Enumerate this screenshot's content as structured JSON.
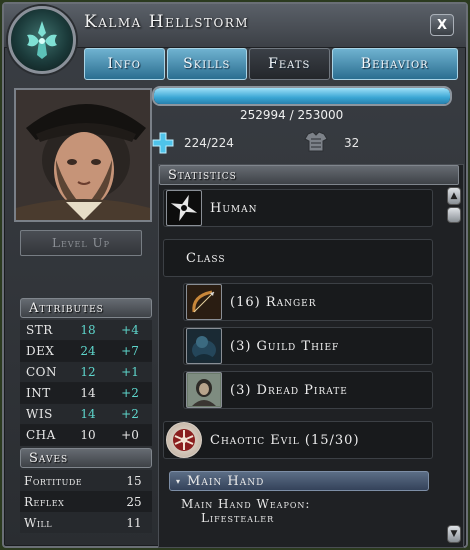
{
  "window": {
    "title": "Kalma Hellstorm",
    "close_label": "X"
  },
  "tabs": [
    {
      "label": "Info"
    },
    {
      "label": "Skills"
    },
    {
      "label": "Feats"
    },
    {
      "label": "Behavior"
    }
  ],
  "left": {
    "level_up_label": "Level Up",
    "attributes_title": "Attributes",
    "attributes": [
      {
        "name": "STR",
        "value": "18",
        "mod": "+4"
      },
      {
        "name": "DEX",
        "value": "24",
        "mod": "+7"
      },
      {
        "name": "CON",
        "value": "12",
        "mod": "+1"
      },
      {
        "name": "INT",
        "value": "14",
        "mod": "+2"
      },
      {
        "name": "WIS",
        "value": "14",
        "mod": "+2"
      },
      {
        "name": "CHA",
        "value": "10",
        "mod": "+0"
      }
    ],
    "saves_title": "Saves",
    "saves": [
      {
        "name": "Fortitude",
        "value": "15"
      },
      {
        "name": "Reflex",
        "value": "25"
      },
      {
        "name": "Will",
        "value": "11"
      }
    ]
  },
  "experience": {
    "text": "252994 / 253000",
    "fill_fraction": 0.99998
  },
  "vitals": {
    "hp": "224/224",
    "ac": "32"
  },
  "statistics": {
    "title": "Statistics",
    "race": "Human",
    "class_label": "Class",
    "classes": [
      {
        "label": "(16) Ranger",
        "icon": "bow-icon"
      },
      {
        "label": "(3) Guild Thief",
        "icon": "thief-icon"
      },
      {
        "label": "(3) Dread Pirate",
        "icon": "pirate-icon"
      }
    ],
    "alignment": "Chaotic Evil (15/30)",
    "main_hand_title": "Main Hand",
    "main_hand_weapon_label": "Main Hand Weapon:",
    "main_hand_weapon": "Lifestealer"
  },
  "colors": {
    "accent": "#3aa6d4",
    "stat_highlight": "#5ed6cc"
  }
}
